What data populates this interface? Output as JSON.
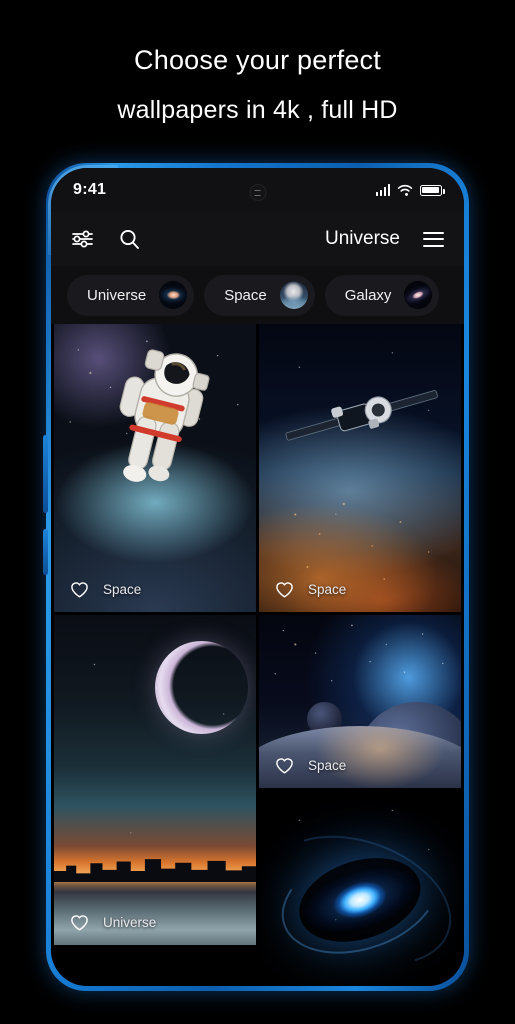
{
  "headline": {
    "line1": "Choose your perfect",
    "line2": "wallpapers in 4k , full HD"
  },
  "phone": {
    "frame_color": "#1477cf",
    "status_bar": {
      "time": "9:41",
      "signal_icon": "signal-bars-icon",
      "wifi_icon": "wifi-icon",
      "battery_icon": "battery-full-icon",
      "camera_icon": "punch-hole-camera-icon"
    },
    "app_bar": {
      "filter_icon": "sliders-filter-icon",
      "search_icon": "search-icon",
      "title": "Universe",
      "menu_icon": "hamburger-menu-icon"
    },
    "chips": [
      {
        "label": "Universe",
        "thumb": "spiral-galaxy-thumb"
      },
      {
        "label": "Space",
        "thumb": "astronaut-thumb"
      },
      {
        "label": "Galaxy",
        "thumb": "galaxy-thumb"
      }
    ],
    "wallpapers": [
      {
        "label": "Space",
        "art": "astronaut-floating-above-earth",
        "favorite_icon": "heart-outline-icon"
      },
      {
        "label": "Space",
        "art": "satellite-orbiting-earth-night-city-lights",
        "favorite_icon": "heart-outline-icon"
      },
      {
        "label": "Universe",
        "art": "crescent-moon-over-city-skyline-water-reflection",
        "favorite_icon": "heart-outline-icon"
      },
      {
        "label": "Space",
        "art": "planets-with-blue-nebula",
        "favorite_icon": "heart-outline-icon"
      },
      {
        "label": "",
        "art": "blue-spiral-galaxy-vortex",
        "favorite_icon": ""
      }
    ]
  }
}
